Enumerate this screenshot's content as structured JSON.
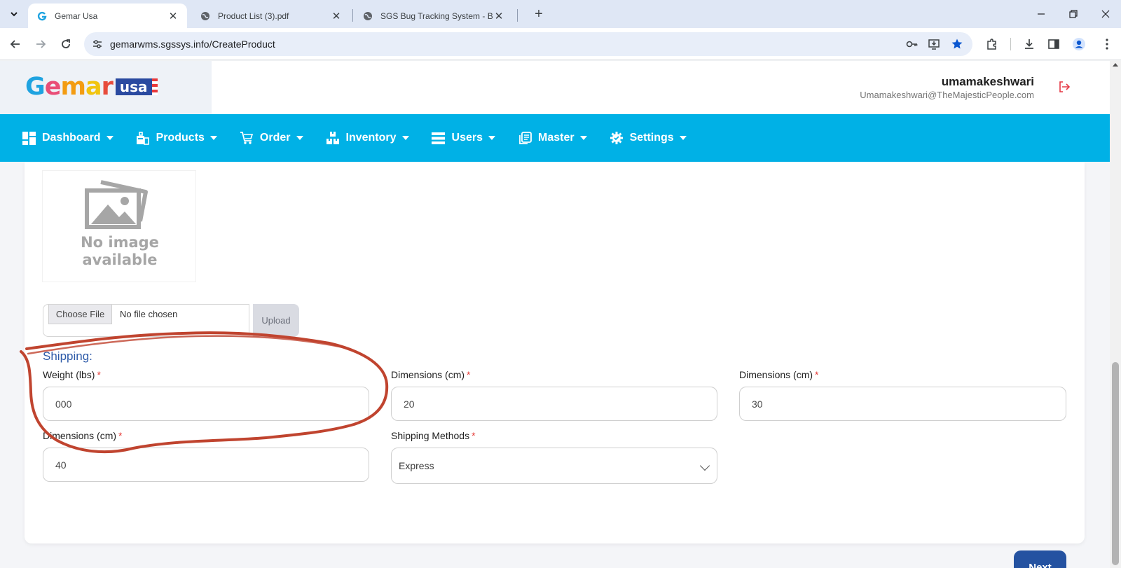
{
  "browser": {
    "tabs": [
      {
        "title": "Gemar Usa",
        "active": true,
        "icon": "gemar-favicon"
      },
      {
        "title": "Product List (3).pdf",
        "active": false,
        "icon": "globe-icon"
      },
      {
        "title": "SGS Bug Tracking System - Beta",
        "active": false,
        "icon": "globe-icon"
      }
    ],
    "url": "gemarwms.sgssys.info/CreateProduct"
  },
  "header": {
    "logo_word": "Gemar",
    "logo_badge": "usa",
    "user_name": "umamakeshwari",
    "user_email": "Umamakeshwari@TheMajesticPeople.com"
  },
  "nav": {
    "items": [
      {
        "label": "Dashboard",
        "icon": "dashboard-icon"
      },
      {
        "label": "Products",
        "icon": "products-icon"
      },
      {
        "label": "Order",
        "icon": "cart-icon"
      },
      {
        "label": "Inventory",
        "icon": "boxes-icon"
      },
      {
        "label": "Users",
        "icon": "list-icon"
      },
      {
        "label": "Master",
        "icon": "copy-icon"
      },
      {
        "label": "Settings",
        "icon": "gear-icon"
      }
    ]
  },
  "image_section": {
    "placeholder_line1": "No image",
    "placeholder_line2": "available",
    "choose_file": "Choose File",
    "no_file": "No file chosen",
    "upload": "Upload"
  },
  "shipping": {
    "title": "Shipping:",
    "weight_label": "Weight (lbs)",
    "weight_value": "000",
    "dim1_label": "Dimensions (cm)",
    "dim1_value": "20",
    "dim2_label": "Dimensions (cm)",
    "dim2_value": "30",
    "dim3_label": "Dimensions (cm)",
    "dim3_value": "40",
    "methods_label": "Shipping Methods",
    "methods_value": "Express",
    "required_mark": "*"
  },
  "actions": {
    "next": "Next"
  },
  "colors": {
    "nav_bg": "#00b1e6",
    "primary_button": "#2452a1",
    "required": "#e53935",
    "annotation": "#c0442f"
  }
}
